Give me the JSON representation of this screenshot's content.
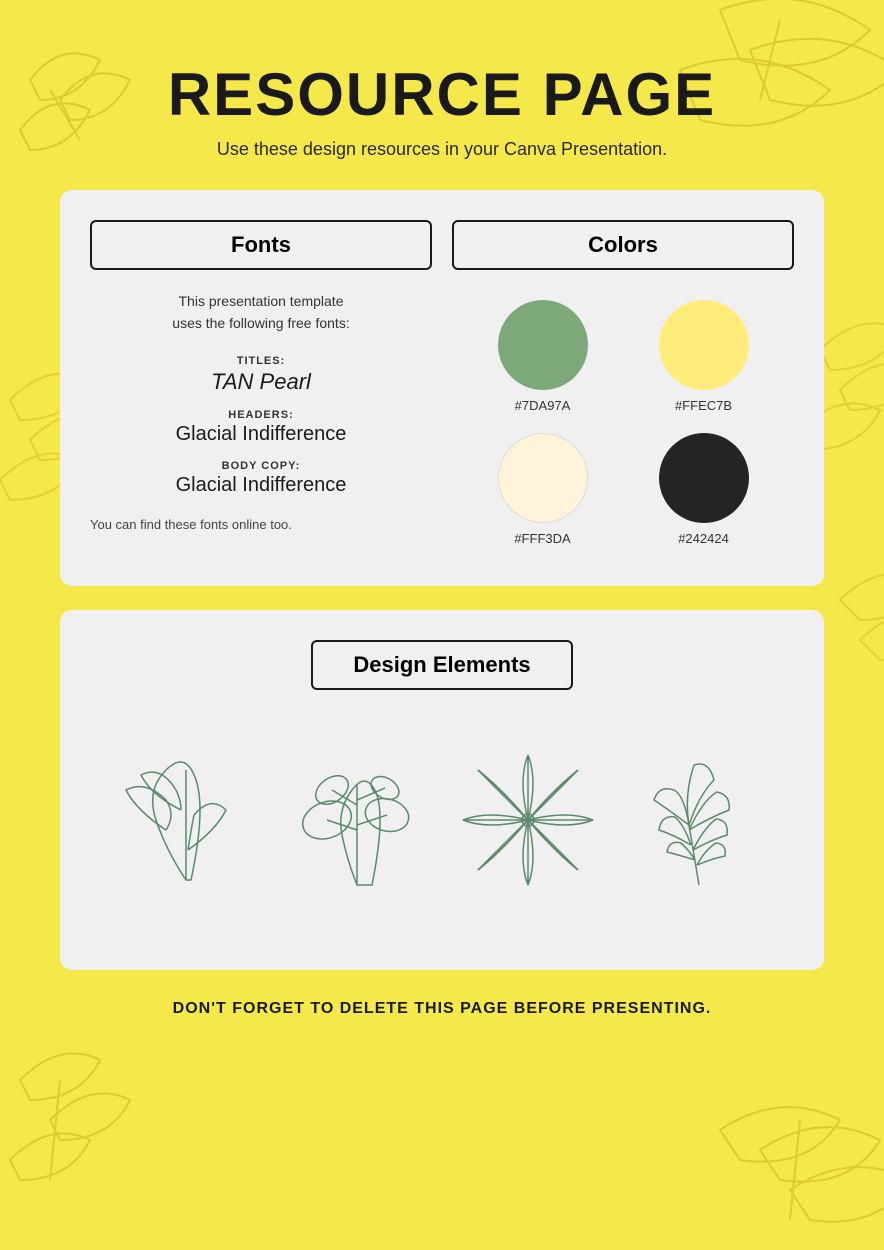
{
  "page": {
    "title": "RESOURCE PAGE",
    "subtitle": "Use these design resources in your Canva Presentation.",
    "background_color": "#F5E84A"
  },
  "fonts_section": {
    "header": "Fonts",
    "intro_line1": "This presentation template",
    "intro_line2": "uses the following free fonts:",
    "titles_label": "TITLES:",
    "titles_font": "TAN Pearl",
    "headers_label": "HEADERS:",
    "headers_font": "Glacial Indifference",
    "body_label": "BODY COPY:",
    "body_font": "Glacial Indifference",
    "footer": "You can find these fonts online too."
  },
  "colors_section": {
    "header": "Colors",
    "colors": [
      {
        "hex": "#7DA97A",
        "label": "#7DA97A"
      },
      {
        "hex": "#FFEC7B",
        "label": "#FFEC7B"
      },
      {
        "hex": "#FFF3DA",
        "label": "#FFF3DA"
      },
      {
        "hex": "#242424",
        "label": "#242424"
      }
    ]
  },
  "design_elements": {
    "header": "Design Elements"
  },
  "footer": {
    "note": "DON'T FORGET TO DELETE THIS PAGE BEFORE PRESENTING."
  }
}
